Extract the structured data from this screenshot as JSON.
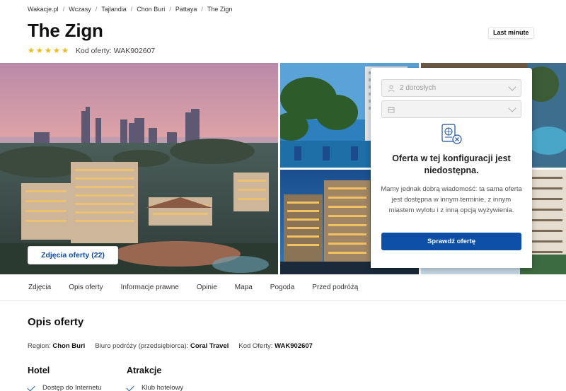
{
  "breadcrumb": [
    "Wakacje.pl",
    "Wczasy",
    "Tajlandia",
    "Chon Buri",
    "Pattaya",
    "The Zign"
  ],
  "hotel": {
    "name": "The Zign",
    "stars": 5,
    "star_glyph": "★",
    "code_label": "Kod oferty: WAK902607",
    "badge": "Last minute"
  },
  "gallery": {
    "photos_button": "Zdjęcia oferty (22)"
  },
  "booking_panel": {
    "guests_value": "2 dorosłych",
    "date_value": "",
    "unavailable_title": "Oferta w tej konfiguracji jest niedostępna.",
    "unavailable_text": "Mamy jednak dobrą wiadomość: ta sama oferta jest dostępna w innym terminie, z innym miastem wylotu i z inną opcją wyżywienia.",
    "check_button": "Sprawdź ofertę"
  },
  "tabs": [
    "Zdjęcia",
    "Opis oferty",
    "Informacje prawne",
    "Opinie",
    "Mapa",
    "Pogoda",
    "Przed podróżą"
  ],
  "description": {
    "title": "Opis oferty",
    "region_label": "Region:",
    "region_value": "Chon Buri",
    "operator_label": "Biuro podróży (przedsiębiorca):",
    "operator_value": "Coral Travel",
    "code_label": "Kod Oferty:",
    "code_value": "WAK902607"
  },
  "features": {
    "hotel_title": "Hotel",
    "hotel_items": [
      "Dostęp do Internetu"
    ],
    "attractions_title": "Atrakcje",
    "attraction_items": [
      "Klub hotelowy"
    ]
  },
  "colors": {
    "primary": "#0d4fa6",
    "star": "#f5b800",
    "link": "#0e4aa8"
  }
}
